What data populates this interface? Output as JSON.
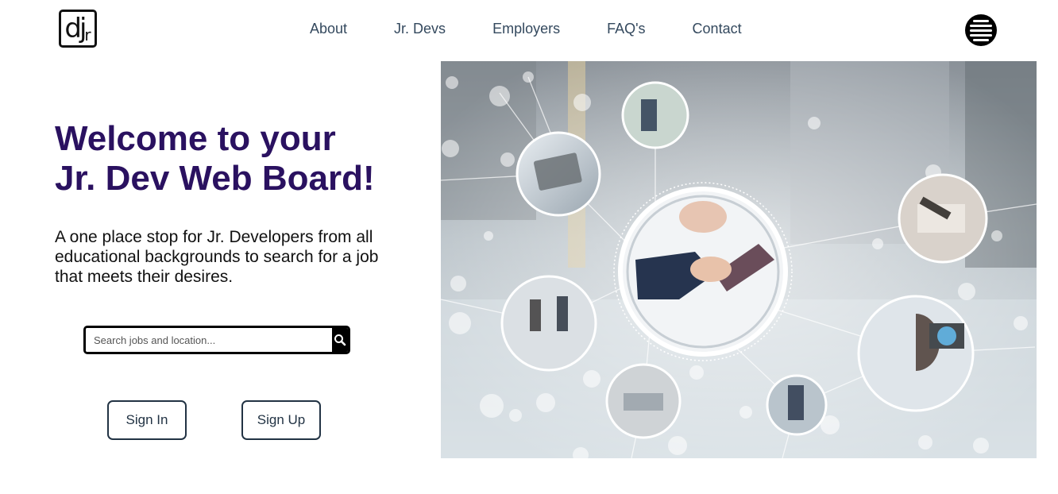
{
  "logo": {
    "main": "dj",
    "sub": "r"
  },
  "nav": {
    "items": [
      {
        "label": "About"
      },
      {
        "label": "Jr. Devs"
      },
      {
        "label": "Employers"
      },
      {
        "label": "FAQ's"
      },
      {
        "label": "Contact"
      }
    ]
  },
  "hero": {
    "title_line1": "Welcome to your",
    "title_line2": "Jr. Dev Web Board!",
    "subtitle": "A one place stop for Jr. Developers from all educational backgrounds to search for a job that meets their desires."
  },
  "search": {
    "placeholder": "Search jobs and location..."
  },
  "buttons": {
    "sign_in": "Sign In",
    "sign_up": "Sign Up"
  },
  "icons": {
    "menu": "hamburger-menu-icon",
    "search": "magnifier-icon"
  },
  "colors": {
    "title": "#2a1160",
    "nav": "#34495e",
    "button_border": "#223344"
  }
}
